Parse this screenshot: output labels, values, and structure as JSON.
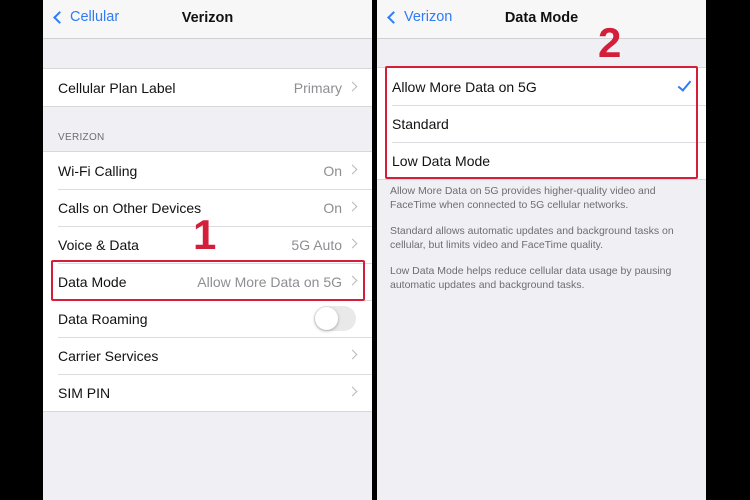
{
  "left_screen": {
    "nav": {
      "back_label": "Cellular",
      "title": "Verizon"
    },
    "plan_label_row": {
      "label": "Cellular Plan Label",
      "value": "Primary"
    },
    "section_header": "VERIZON",
    "rows": [
      {
        "label": "Wi-Fi Calling",
        "value": "On"
      },
      {
        "label": "Calls on Other Devices",
        "value": "On"
      },
      {
        "label": "Voice & Data",
        "value": "5G Auto"
      },
      {
        "label": "Data Mode",
        "value": "Allow More Data on 5G"
      },
      {
        "label": "Data Roaming",
        "toggle": false
      },
      {
        "label": "Carrier Services",
        "value": ""
      },
      {
        "label": "SIM PIN",
        "value": ""
      }
    ]
  },
  "right_screen": {
    "nav": {
      "back_label": "Verizon",
      "title": "Data Mode"
    },
    "options": [
      {
        "label": "Allow More Data on 5G",
        "selected": true
      },
      {
        "label": "Standard",
        "selected": false
      },
      {
        "label": "Low Data Mode",
        "selected": false
      }
    ],
    "notes": [
      "Allow More Data on 5G provides higher-quality video and FaceTime when connected to 5G cellular networks.",
      "Standard allows automatic updates and background tasks on cellular, but limits video and FaceTime quality.",
      "Low Data Mode helps reduce cellular data usage by pausing automatic updates and background tasks."
    ]
  },
  "annotations": {
    "step1": "1",
    "step2": "2",
    "highlight_color": "#d41f3a"
  },
  "colors": {
    "accent": "#2f7cf6",
    "background": "#efeff4"
  }
}
